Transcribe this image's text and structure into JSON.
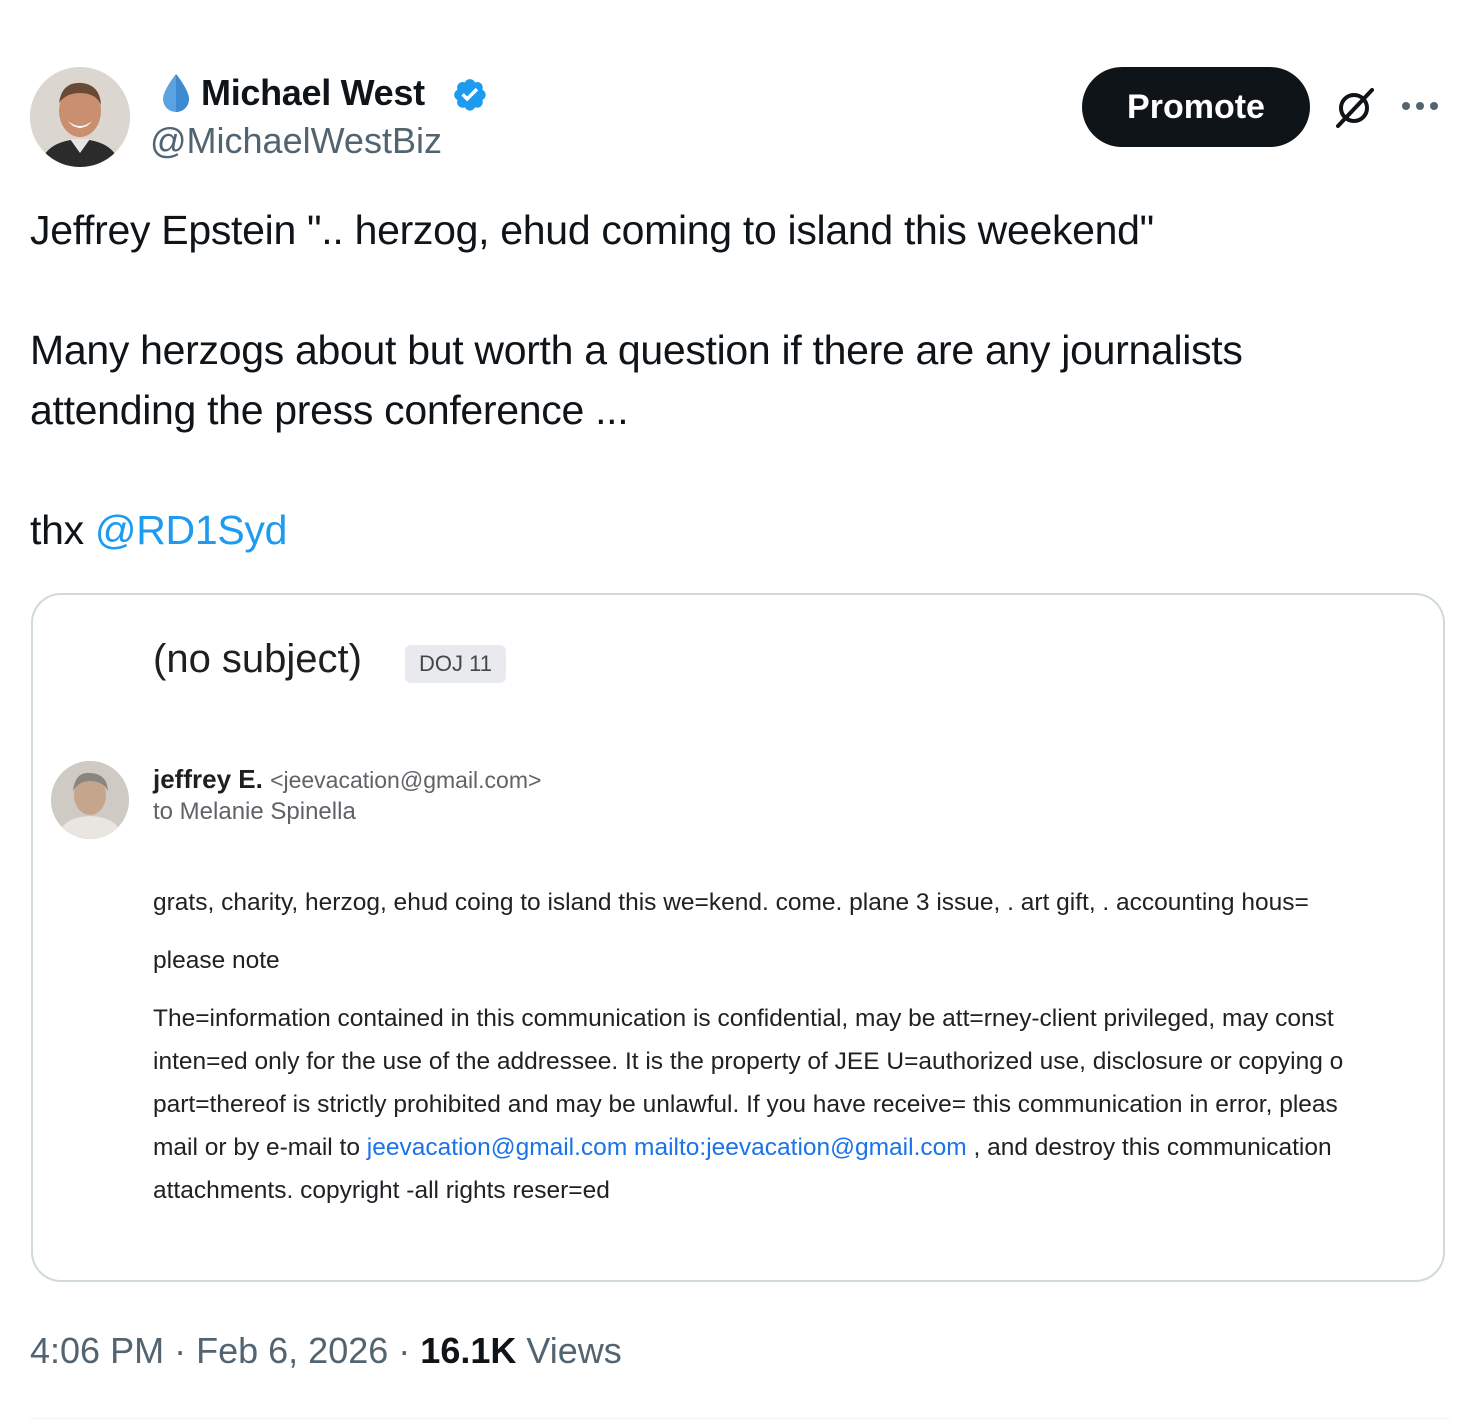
{
  "author": {
    "name": "Michael West",
    "handle": "@MichaelWestBiz"
  },
  "header": {
    "promote_label": "Promote"
  },
  "tweet": {
    "line1": "Jeffrey Epstein \".. herzog, ehud coming to island this weekend\"",
    "para2_line1": "Many herzogs about but worth a question if there are any journalists",
    "para2_line2": "attending the press conference ...",
    "thanks_prefix": "thx",
    "mention": "@RD1Syd"
  },
  "email": {
    "subject": "(no subject)",
    "label": "DOJ 11",
    "sender_name": "jeffrey E.",
    "sender_email": "<jeevacation@gmail.com>",
    "to_line": "to Melanie Spinella",
    "body_line1": "grats, charity, herzog, ehud coing to island this we=kend. come. plane 3 issue, . art gift, . accounting hous=",
    "body_line2": "please note",
    "body_line3": "The=information contained in this communication is confidential, may be att=rney-client privileged, may const",
    "body_line4": "inten=ed only for the use of the addressee. It is the property of JEE U=authorized use, disclosure or copying o",
    "body_line5": "part=thereof is strictly prohibited and may be unlawful. If you have receive= this communication in error, pleas",
    "body_line6_prefix": "mail or by e-mail to",
    "body_link1": "jeevacation@gmail.com",
    "body_link2": "mailto:jeevacation@gmail.com",
    "body_line6_suffix": ", and destroy this communication",
    "body_line7": "attachments. copyright -all rights reser=ed"
  },
  "meta": {
    "time": "4:06 PM",
    "date": "Feb 6, 2026",
    "views_count": "16.1K",
    "views_label": "Views",
    "separator": "·"
  },
  "colors": {
    "accent": "#1d9bf0",
    "text": "#0f1419",
    "secondary": "#536471",
    "link_in_email": "#1a73e8"
  },
  "icons": [
    "water-drop-icon",
    "verified-badge-icon",
    "grok-icon",
    "more-icon"
  ]
}
